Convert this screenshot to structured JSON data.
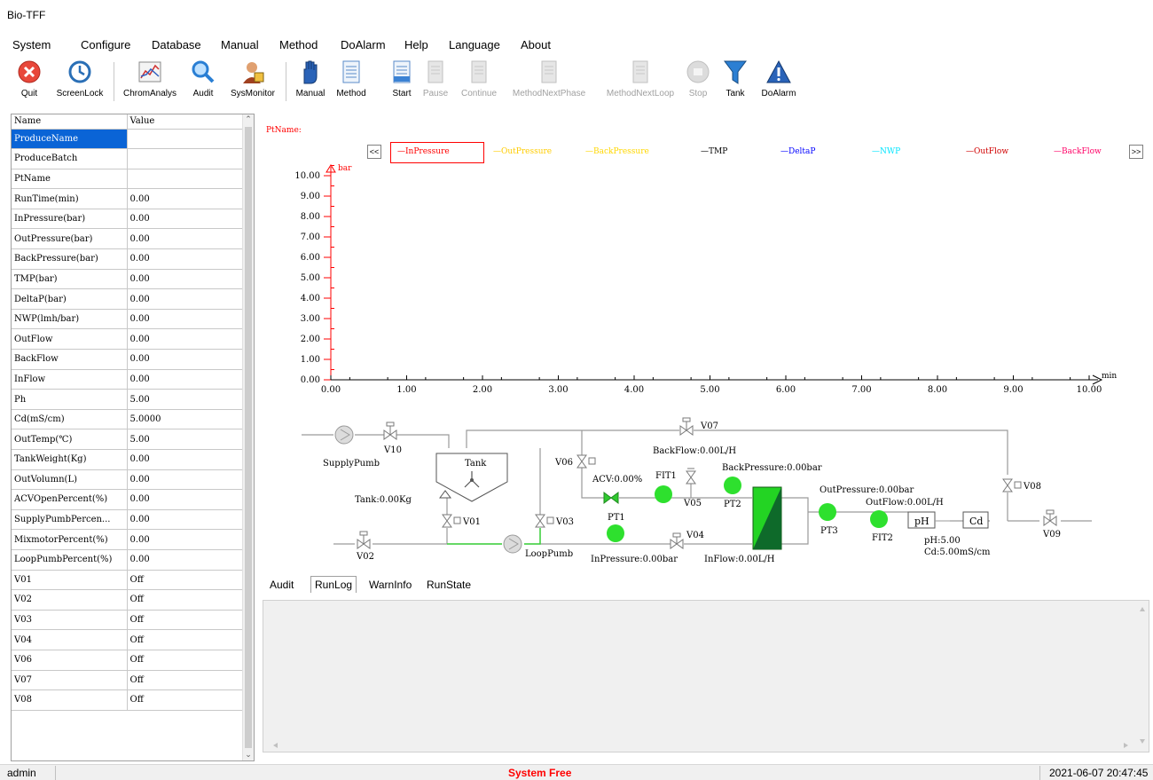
{
  "app": {
    "title": "Bio-TFF"
  },
  "menu": [
    "System",
    "Configure",
    "Database",
    "Manual",
    "Method",
    "DoAlarm",
    "Help",
    "Language",
    "About"
  ],
  "toolbar": [
    {
      "label": "Quit",
      "icon": "quit-icon",
      "enabled": true
    },
    {
      "label": "ScreenLock",
      "icon": "screenlock-icon",
      "enabled": true
    },
    {
      "label": "ChromAnalys",
      "icon": "chart-icon",
      "enabled": true
    },
    {
      "label": "Audit",
      "icon": "magnifier-icon",
      "enabled": true
    },
    {
      "label": "SysMonitor",
      "icon": "user-monitor-icon",
      "enabled": true
    },
    {
      "label": "Manual",
      "icon": "hand-icon",
      "enabled": true
    },
    {
      "label": "Method",
      "icon": "document-icon",
      "enabled": true
    },
    {
      "label": "Start",
      "icon": "document-start-icon",
      "enabled": true
    },
    {
      "label": "Pause",
      "icon": "document-pause-icon",
      "enabled": false
    },
    {
      "label": "Continue",
      "icon": "document-continue-icon",
      "enabled": false
    },
    {
      "label": "MethodNextPhase",
      "icon": "document-next-phase-icon",
      "enabled": false
    },
    {
      "label": "MethodNextLoop",
      "icon": "document-next-loop-icon",
      "enabled": false
    },
    {
      "label": "Stop",
      "icon": "stop-icon",
      "enabled": false
    },
    {
      "label": "Tank",
      "icon": "funnel-icon",
      "enabled": true
    },
    {
      "label": "DoAlarm",
      "icon": "warning-icon",
      "enabled": true
    }
  ],
  "grid": {
    "headers": [
      "Name",
      "Value"
    ],
    "rows": [
      {
        "name": "ProduceName",
        "value": ""
      },
      {
        "name": "ProduceBatch",
        "value": ""
      },
      {
        "name": "PtName",
        "value": ""
      },
      {
        "name": "RunTime(min)",
        "value": "0.00"
      },
      {
        "name": "InPressure(bar)",
        "value": "0.00"
      },
      {
        "name": "OutPressure(bar)",
        "value": "0.00"
      },
      {
        "name": "BackPressure(bar)",
        "value": "0.00"
      },
      {
        "name": "TMP(bar)",
        "value": "0.00"
      },
      {
        "name": "DeltaP(bar)",
        "value": "0.00"
      },
      {
        "name": "NWP(lmh/bar)",
        "value": "0.00"
      },
      {
        "name": "OutFlow",
        "value": "0.00"
      },
      {
        "name": "BackFlow",
        "value": "0.00"
      },
      {
        "name": "InFlow",
        "value": "0.00"
      },
      {
        "name": "Ph",
        "value": "5.00"
      },
      {
        "name": "Cd(mS/cm)",
        "value": "5.0000"
      },
      {
        "name": "OutTemp(℃)",
        "value": "5.00"
      },
      {
        "name": "TankWeight(Kg)",
        "value": "0.00"
      },
      {
        "name": "OutVolumn(L)",
        "value": "0.00"
      },
      {
        "name": "ACVOpenPercent(%)",
        "value": "0.00"
      },
      {
        "name": "SupplyPumbPercen...",
        "value": "0.00"
      },
      {
        "name": "MixmotorPercent(%)",
        "value": "0.00"
      },
      {
        "name": "LoopPumbPercent(%)",
        "value": "0.00"
      },
      {
        "name": "V01",
        "value": "Off"
      },
      {
        "name": "V02",
        "value": "Off"
      },
      {
        "name": "V03",
        "value": "Off"
      },
      {
        "name": "V04",
        "value": "Off"
      },
      {
        "name": "V06",
        "value": "Off"
      },
      {
        "name": "V07",
        "value": "Off"
      },
      {
        "name": "V08",
        "value": "Off"
      }
    ]
  },
  "chart": {
    "ptname_label": "PtName:",
    "nav_prev": "<<",
    "nav_next": ">>",
    "legend": [
      {
        "name": "InPressure",
        "color": "#ff0000"
      },
      {
        "name": "OutPressure",
        "color": "#ffcc00"
      },
      {
        "name": "BackPressure",
        "color": "#ffd700"
      },
      {
        "name": "TMP",
        "color": "#000000"
      },
      {
        "name": "DeltaP",
        "color": "#0000ff"
      },
      {
        "name": "NWP",
        "color": "#00e5ff"
      },
      {
        "name": "OutFlow",
        "color": "#d00000"
      },
      {
        "name": "BackFlow",
        "color": "#ff0066"
      }
    ]
  },
  "chart_data": {
    "type": "line",
    "title": "",
    "ylabel": "bar",
    "xlabel": "min",
    "xlim": [
      0,
      10
    ],
    "ylim": [
      0,
      10
    ],
    "x_ticks": [
      "0.00",
      "1.00",
      "2.00",
      "3.00",
      "4.00",
      "5.00",
      "6.00",
      "7.00",
      "8.00",
      "9.00",
      "10.00"
    ],
    "y_ticks": [
      "0.00",
      "1.00",
      "2.00",
      "3.00",
      "4.00",
      "5.00",
      "6.00",
      "7.00",
      "8.00",
      "9.00",
      "10.00"
    ],
    "series": [],
    "grid": false
  },
  "process": {
    "labels": {
      "supply_pump": "SupplyPumb",
      "v10": "V10",
      "tank": "Tank",
      "tank_weight": "Tank:0.00Kg",
      "v01": "V01",
      "v02": "V02",
      "v03": "V03",
      "loop_pump": "LoopPumb",
      "v06": "V06",
      "v07": "V07",
      "backflow": "BackFlow:0.00L/H",
      "acv": "ACV:0.00%",
      "fit1": "FIT1",
      "v05": "V05",
      "backpressure": "BackPressure:0.00bar",
      "pt2": "PT2",
      "pt1": "PT1",
      "v04": "V04",
      "inpressure": "InPressure:0.00bar",
      "inflow": "InFlow:0.00L/H",
      "outpressure": "OutPressure:0.00bar",
      "outflow": "OutFlow:0.00L/H",
      "pt3": "PT3",
      "fit2": "FIT2",
      "ph_box": "pH",
      "cd_box": "Cd",
      "ph_value": "pH:5.00",
      "cd_value": "Cd:5.00mS/cm",
      "v08": "V08",
      "v09": "V09"
    }
  },
  "tabs": [
    "Audit",
    "RunLog",
    "WarnInfo",
    "RunState"
  ],
  "active_tab": "RunLog",
  "status": {
    "user": "admin",
    "state": "System Free",
    "datetime": "2021-06-07 20:47:45"
  }
}
